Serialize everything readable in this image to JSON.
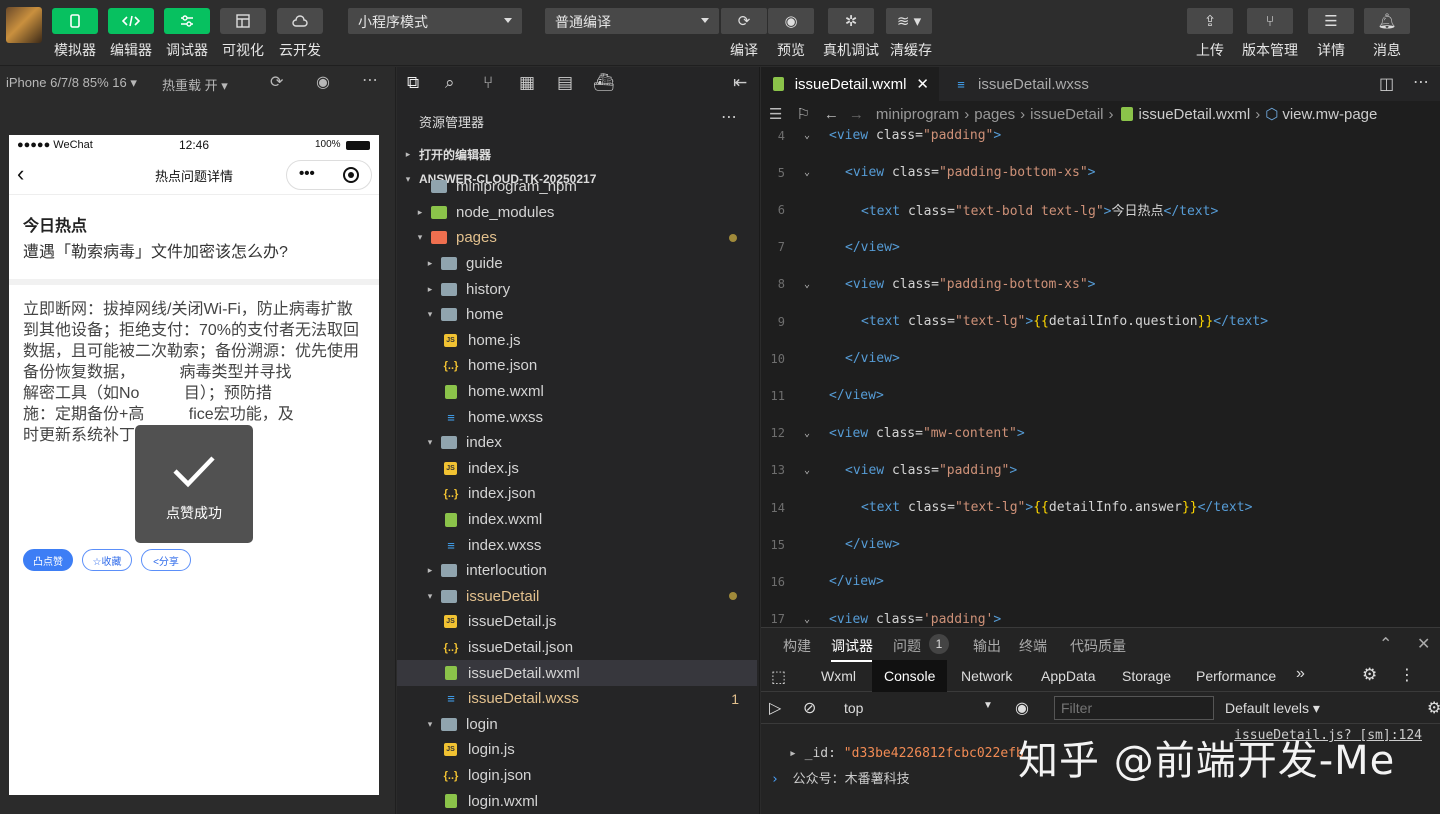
{
  "toolbar": {
    "left_buttons": [
      {
        "label": "模拟器",
        "icon": "phone-icon"
      },
      {
        "label": "编辑器",
        "icon": "code-icon"
      },
      {
        "label": "调试器",
        "icon": "debug-icon"
      },
      {
        "label": "可视化",
        "icon": "layout-icon"
      },
      {
        "label": "云开发",
        "icon": "cloud-icon"
      }
    ],
    "mode_select": "小程序模式",
    "compile_select": "普通编译",
    "right_actions": [
      {
        "label": "编译",
        "icon": "refresh-icon"
      },
      {
        "label": "预览",
        "icon": "eye-icon"
      },
      {
        "label": "真机调试",
        "icon": "bug-icon"
      },
      {
        "label": "清缓存",
        "icon": "layers-icon"
      }
    ],
    "far_right": [
      {
        "label": "上传",
        "icon": "upload-icon"
      },
      {
        "label": "版本管理",
        "icon": "branch-icon"
      },
      {
        "label": "详情",
        "icon": "menu-icon"
      },
      {
        "label": "消息",
        "icon": "bell-icon"
      }
    ]
  },
  "simulator": {
    "device": "iPhone 6/7/8 85% 16",
    "hot_reload": "热重载 开",
    "status_left": "●●●●● WeChat",
    "status_time": "12:46",
    "status_battery": "100%",
    "nav_title": "热点问题详情",
    "heading": "今日热点",
    "question": "遭遇「勒索病毒」文件加密该怎么办?",
    "answer_lines": [
      "立即断网：拔掉网线/关闭Wi-Fi，防止病毒扩散",
      "到其他设备；拒绝支付：70%的支付者无法取回",
      "数据，且可能被二次勒索；备份溯源：优先使用",
      "备份恢复数据，          病毒类型并寻找",
      "解密工具（如No          目）；预防措",
      "施：定期备份+高          fice宏功能，及",
      "时更新系统补丁"
    ],
    "buttons": [
      "凸点赞",
      "☆收藏",
      "<分享"
    ],
    "toast": "点赞成功"
  },
  "explorer": {
    "title": "资源管理器",
    "sections": [
      "打开的编辑器",
      "ANSWER-CLOUD-TK-20250217"
    ],
    "items": [
      {
        "name": "miniprogram_npm",
        "type": "folder",
        "depth": 1,
        "arrow": ""
      },
      {
        "name": "node_modules",
        "type": "folder-green",
        "depth": 1,
        "arrow": "▸"
      },
      {
        "name": "pages",
        "type": "folder-red",
        "depth": 1,
        "arrow": "▾",
        "mod": true,
        "color": "#e2c08d"
      },
      {
        "name": "guide",
        "type": "folder",
        "depth": 2,
        "arrow": "▸"
      },
      {
        "name": "history",
        "type": "folder",
        "depth": 2,
        "arrow": "▸"
      },
      {
        "name": "home",
        "type": "folder",
        "depth": 2,
        "arrow": "▾"
      },
      {
        "name": "home.js",
        "type": "js",
        "depth": 3
      },
      {
        "name": "home.json",
        "type": "json",
        "depth": 3
      },
      {
        "name": "home.wxml",
        "type": "wxml",
        "depth": 3
      },
      {
        "name": "home.wxss",
        "type": "wxss",
        "depth": 3
      },
      {
        "name": "index",
        "type": "folder",
        "depth": 2,
        "arrow": "▾"
      },
      {
        "name": "index.js",
        "type": "js",
        "depth": 3
      },
      {
        "name": "index.json",
        "type": "json",
        "depth": 3
      },
      {
        "name": "index.wxml",
        "type": "wxml",
        "depth": 3
      },
      {
        "name": "index.wxss",
        "type": "wxss",
        "depth": 3
      },
      {
        "name": "interlocution",
        "type": "folder",
        "depth": 2,
        "arrow": "▸"
      },
      {
        "name": "issueDetail",
        "type": "folder",
        "depth": 2,
        "arrow": "▾",
        "mod": true,
        "color": "#e2c08d"
      },
      {
        "name": "issueDetail.js",
        "type": "js",
        "depth": 3
      },
      {
        "name": "issueDetail.json",
        "type": "json",
        "depth": 3
      },
      {
        "name": "issueDetail.wxml",
        "type": "wxml",
        "depth": 3,
        "selected": true
      },
      {
        "name": "issueDetail.wxss",
        "type": "wxss",
        "depth": 3,
        "badge": "1",
        "color": "#e2c08d"
      },
      {
        "name": "login",
        "type": "folder",
        "depth": 2,
        "arrow": "▾"
      },
      {
        "name": "login.js",
        "type": "js",
        "depth": 3
      },
      {
        "name": "login.json",
        "type": "json",
        "depth": 3
      },
      {
        "name": "login.wxml",
        "type": "wxml",
        "depth": 3
      }
    ]
  },
  "editor": {
    "tabs": [
      {
        "label": "issueDetail.wxml",
        "active": true
      },
      {
        "label": "issueDetail.wxss",
        "active": false
      }
    ],
    "breadcrumb": [
      "miniprogram",
      "pages",
      "issueDetail",
      "issueDetail.wxml",
      "view.mw-page"
    ],
    "lines": [
      {
        "n": "4",
        "indent": 0,
        "fold": "⌄",
        "code": "<view class=\"padding\">"
      },
      {
        "n": "5",
        "indent": 1,
        "fold": "⌄",
        "code": "<view class=\"padding-bottom-xs\">"
      },
      {
        "n": "6",
        "indent": 2,
        "fold": "",
        "code": "<text class=\"text-bold text-lg\">今日热点</text>"
      },
      {
        "n": "7",
        "indent": 1,
        "fold": "",
        "code": "</view>"
      },
      {
        "n": "8",
        "indent": 1,
        "fold": "⌄",
        "code": "<view class=\"padding-bottom-xs\">"
      },
      {
        "n": "9",
        "indent": 2,
        "fold": "",
        "code": "<text class=\"text-lg\">{{detailInfo.question}}</text>"
      },
      {
        "n": "10",
        "indent": 1,
        "fold": "",
        "code": "</view>"
      },
      {
        "n": "11",
        "indent": 0,
        "fold": "",
        "code": "</view>"
      },
      {
        "n": "12",
        "indent": 0,
        "fold": "⌄",
        "code": "<view class=\"mw-content\">"
      },
      {
        "n": "13",
        "indent": 1,
        "fold": "⌄",
        "code": "<view class=\"padding\">"
      },
      {
        "n": "14",
        "indent": 2,
        "fold": "",
        "code": "<text class=\"text-lg\">{{detailInfo.answer}}</text>"
      },
      {
        "n": "15",
        "indent": 1,
        "fold": "",
        "code": "</view>"
      },
      {
        "n": "16",
        "indent": 0,
        "fold": "",
        "code": "</view>"
      },
      {
        "n": "17",
        "indent": 0,
        "fold": "⌄",
        "code": "<view class='padding'>"
      }
    ]
  },
  "devtools": {
    "tabs": [
      "构建",
      "调试器",
      "问题",
      "输出",
      "终端",
      "代码质量"
    ],
    "issues_count": "1",
    "subtabs": [
      "Wxml",
      "Console",
      "Network",
      "AppData",
      "Storage",
      "Performance"
    ],
    "context": "top",
    "filter_placeholder": "Filter",
    "levels": "Default levels",
    "log_source": "issueDetail.js? [sm]:124",
    "log_line": "{_id: \"d33be4226812fcbc022efb3a25c5...\", content: \"...\", ...}",
    "log_key": "_id:",
    "log_val": "\"d33be4226812fcbc022efb",
    "log_line2": "公众号：木番薯科技",
    "watermark": "知乎 @前端开发-Me"
  },
  "colors": {
    "accent_green": "#07c160",
    "editor_bg": "#1e1e1e",
    "explorer_bg": "#252526"
  }
}
